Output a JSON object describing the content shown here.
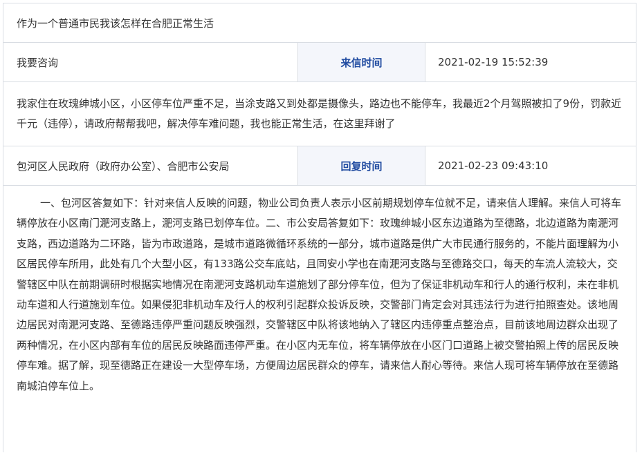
{
  "title": "作为一个普通市民我该怎样在合肥正常生活",
  "ask": {
    "category": "我要咨询",
    "label": "来信时间",
    "time": "2021-02-19 15:52:39"
  },
  "content": "我家住在玫瑰绅城小区，小区停车位严重不足，当涂支路又到处都是摄像头，路边也不能停车，我最近2个月驾照被扣了9份，罚款近千元（违停），请政府帮帮我吧，解决停车难问题，我也能正常生活，在这里拜谢了",
  "reply": {
    "department": "包河区人民政府（政府办公室）、合肥市公安局",
    "label": "回复时间",
    "time": "2021-02-23 09:43:10"
  },
  "answer": "一、包河区答复如下：针对来信人反映的问题，物业公司负责人表示小区前期规划停车位就不足，请来信人理解。来信人可将车辆停放在小区南门淝河支路上，淝河支路已划停车位。二、市公安局答复如下：玫瑰绅城小区东边道路为至德路，北边道路为南淝河支路，西边道路为二环路，皆为市政道路，是城市道路微循环系统的一部分，城市道路是供广大市民通行服务的，不能片面理解为小区居民停车所用，此处有几个大型小区，有133路公交车底站，且同安小学也在南淝河支路与至德路交口，每天的车流人流较大，交警辖区中队在前期调研时根据实地情况在南淝河支路机动车道施划了部分停车位，但为了保证非机动车和行人的通行权利，未在非机动车道和人行道施划车位。如果侵犯非机动车及行人的权利引起群众投诉反映，交警部门肯定会对其违法行为进行拍照查处。该地周边居民对南淝河支路、至德路违停严重问题反映强烈，交警辖区中队将该地纳入了辖区内违停重点整治点，目前该地周边群众出现了两种情况，在小区内部有车位的居民反映路面违停严重。在小区内无车位，将车辆停放在小区门口道路上被交警拍照上传的居民反映停车难。据了解，现至德路正在建设一大型停车场，方便周边居民群众的停车，请来信人耐心等待。来信人现可将车辆停放在至德路南城泊停车位上。"
}
